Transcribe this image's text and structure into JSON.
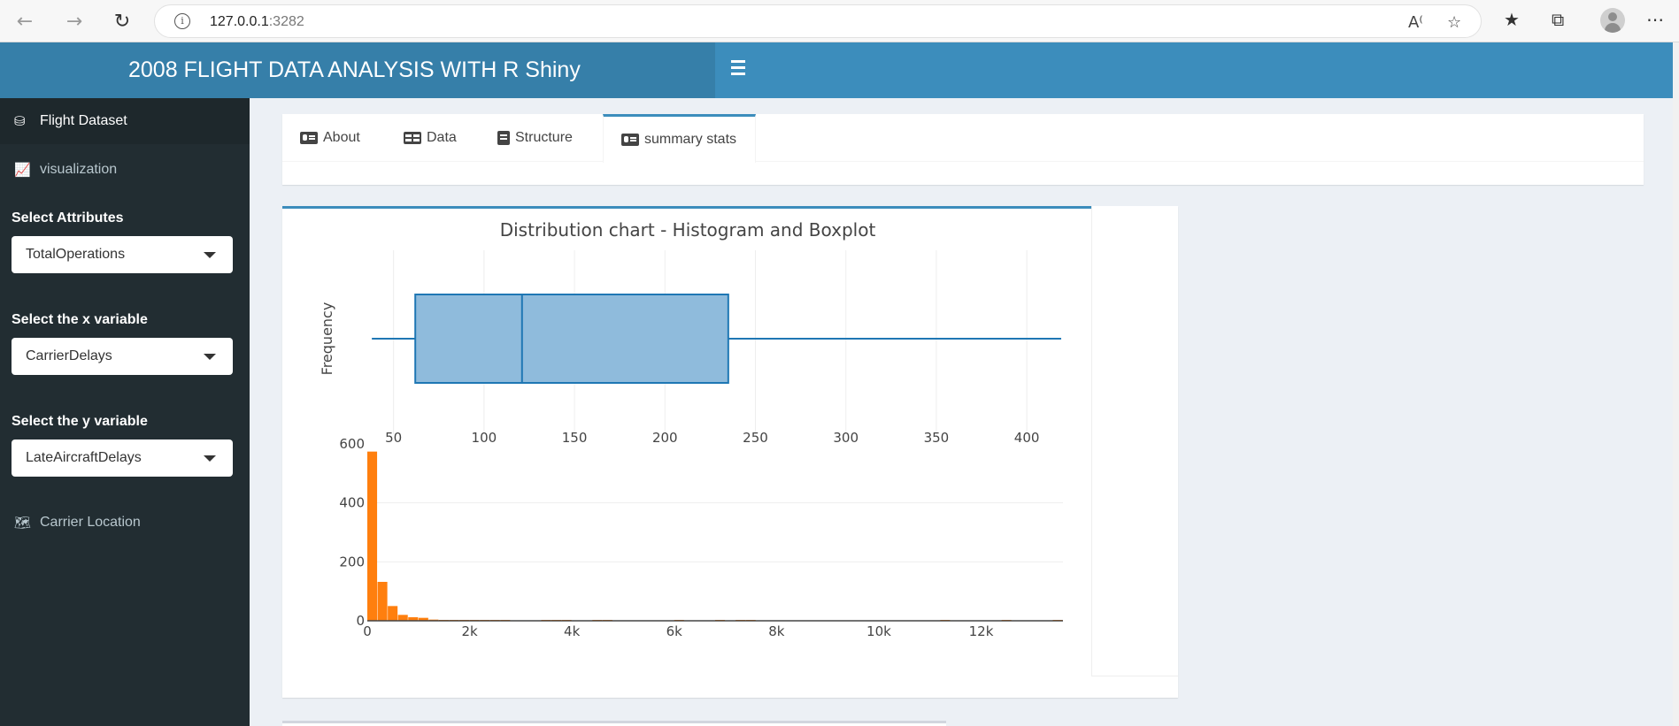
{
  "browser": {
    "url_host": "127.0.0.1",
    "url_port": ":3282"
  },
  "header": {
    "title": "2008 FLIGHT DATA ANALYSIS WITH R Shiny"
  },
  "sidebar": {
    "items": [
      {
        "label": "Flight Dataset",
        "icon": "database-icon"
      },
      {
        "label": "visualization",
        "icon": "line-chart-icon"
      },
      {
        "label": "Carrier Location",
        "icon": "map-icon"
      }
    ],
    "attributes": {
      "label": "Select Attributes",
      "value": "TotalOperations"
    },
    "x_variable": {
      "label": "Select the x variable",
      "value": "CarrierDelays"
    },
    "y_variable": {
      "label": "Select the y variable",
      "value": "LateAircraftDelays"
    }
  },
  "tabs": [
    {
      "label": "About",
      "icon": "id-card-icon"
    },
    {
      "label": "Data",
      "icon": "table-icon"
    },
    {
      "label": "Structure",
      "icon": "file-icon"
    },
    {
      "label": "summary stats",
      "icon": "id-card-icon",
      "active": true
    }
  ],
  "colors": {
    "header": "#3c8dbc",
    "sidebar": "#222d32",
    "boxplot_fill": "#8fbbdc",
    "boxplot_stroke": "#1f77b4",
    "histogram": "#ff7f0e"
  },
  "chart_data": [
    {
      "type": "boxplot",
      "title": "Distribution chart - Histogram and Boxplot",
      "ylabel": "Frequency",
      "xlim": [
        35,
        420
      ],
      "xticks": [
        50,
        100,
        150,
        200,
        250,
        300,
        350,
        400
      ],
      "xtick_labels": [
        "50",
        "100",
        "150",
        "200",
        "250",
        "300",
        "350",
        "400"
      ],
      "whisker_low": 38,
      "q1": 62,
      "median": 121,
      "q3": 235,
      "whisker_high": 419
    },
    {
      "type": "bar",
      "xlim": [
        0,
        13600
      ],
      "ylim": [
        0,
        600
      ],
      "xticks": [
        0,
        2000,
        4000,
        6000,
        8000,
        10000,
        12000
      ],
      "xtick_labels": [
        "0",
        "2k",
        "4k",
        "6k",
        "8k",
        "10k",
        "12k"
      ],
      "yticks": [
        0,
        200,
        400,
        600
      ],
      "ytick_labels": [
        "0",
        "200",
        "400",
        "600"
      ],
      "bin_width": 200,
      "bins": [
        {
          "x": 0,
          "count": 574
        },
        {
          "x": 200,
          "count": 132
        },
        {
          "x": 400,
          "count": 50
        },
        {
          "x": 600,
          "count": 20
        },
        {
          "x": 800,
          "count": 12
        },
        {
          "x": 1000,
          "count": 10
        },
        {
          "x": 1200,
          "count": 4
        },
        {
          "x": 1400,
          "count": 3
        },
        {
          "x": 1600,
          "count": 2
        },
        {
          "x": 1800,
          "count": 2
        },
        {
          "x": 2000,
          "count": 2
        },
        {
          "x": 2200,
          "count": 1
        },
        {
          "x": 2400,
          "count": 2
        },
        {
          "x": 2600,
          "count": 1
        },
        {
          "x": 3400,
          "count": 1
        },
        {
          "x": 3600,
          "count": 1
        },
        {
          "x": 3800,
          "count": 1
        },
        {
          "x": 4400,
          "count": 1
        },
        {
          "x": 4600,
          "count": 1
        },
        {
          "x": 6000,
          "count": 1
        },
        {
          "x": 6800,
          "count": 1
        },
        {
          "x": 7200,
          "count": 1
        },
        {
          "x": 7400,
          "count": 1
        },
        {
          "x": 11200,
          "count": 1
        },
        {
          "x": 12400,
          "count": 1
        },
        {
          "x": 13400,
          "count": 1
        }
      ]
    }
  ]
}
